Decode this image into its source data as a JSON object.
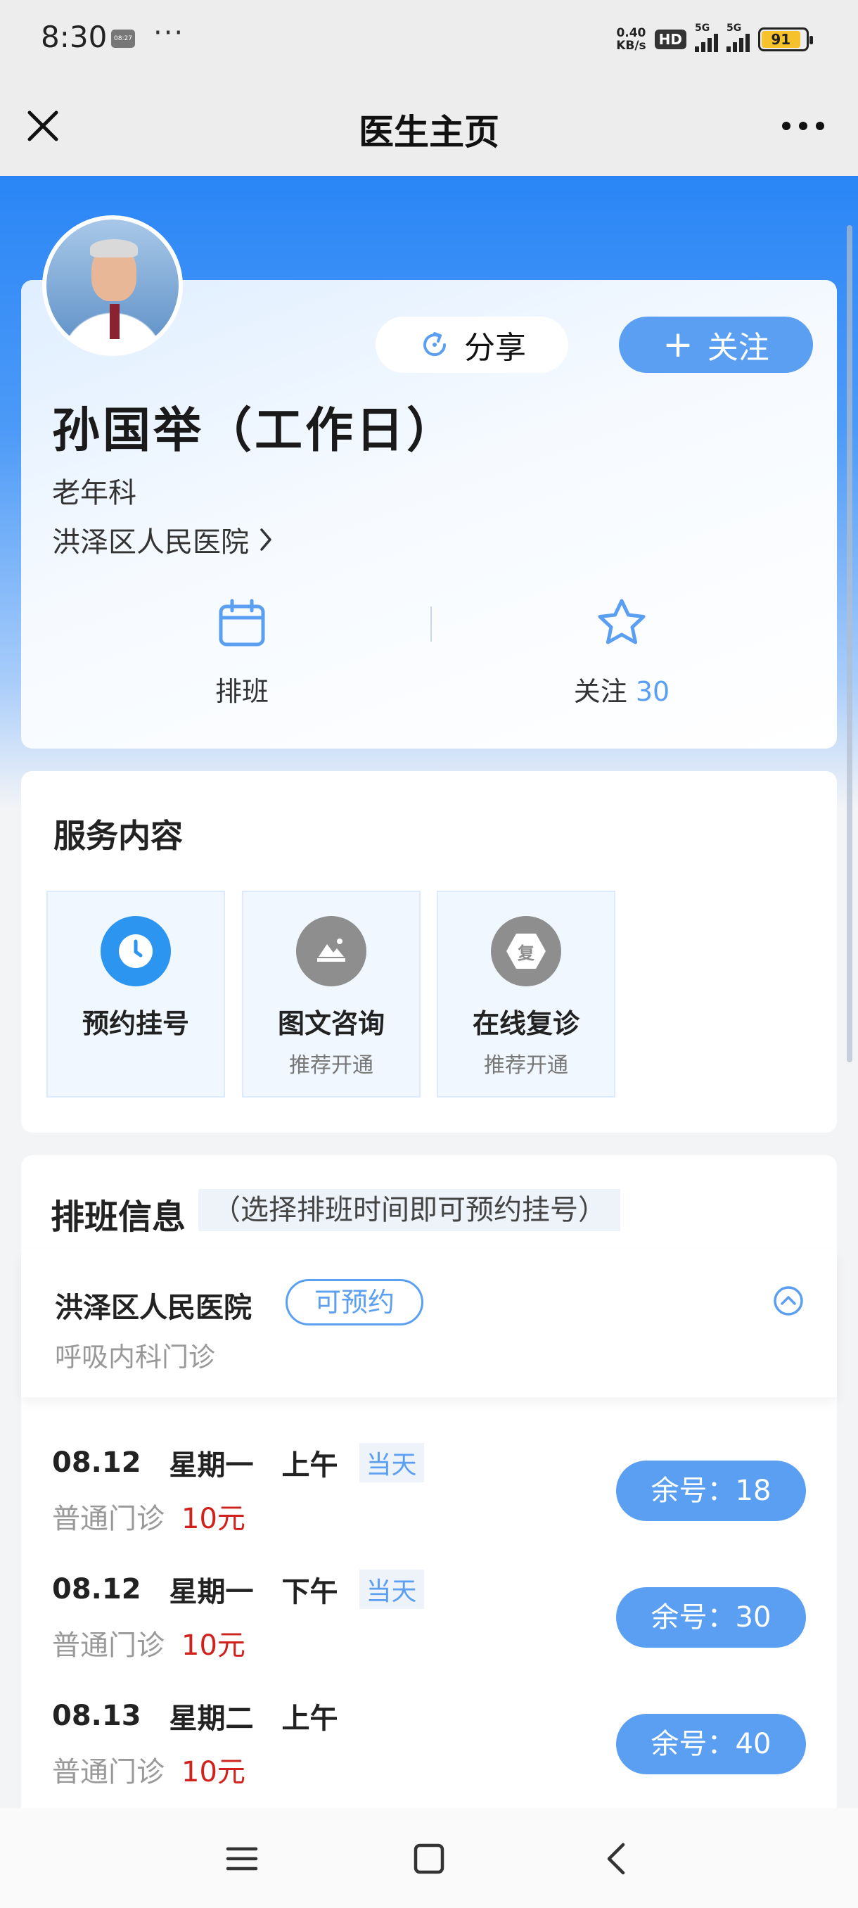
{
  "status_bar": {
    "time": "8:30",
    "mini_icon_text": "08:27",
    "more": "···",
    "net_speed_value": "0.40",
    "net_speed_unit": "KB/s",
    "hd": "HD",
    "signal1": "5G",
    "signal2": "5G",
    "battery": "91"
  },
  "nav": {
    "title": "医生主页"
  },
  "doctor": {
    "name": "孙国举（工作日）",
    "department": "老年科",
    "hospital": "洪泽区人民医院",
    "share_label": "分享",
    "follow_label": "关注",
    "schedule_label": "排班",
    "followers_label": "关注",
    "followers_count": "30"
  },
  "services": {
    "title": "服务内容",
    "items": [
      {
        "title": "预约挂号",
        "subtitle": ""
      },
      {
        "title": "图文咨询",
        "subtitle": "推荐开通"
      },
      {
        "title": "在线复诊",
        "subtitle": "推荐开通",
        "icon_char": "复"
      }
    ]
  },
  "schedule": {
    "title": "排班信息",
    "hint": "（选择排班时间即可预约挂号）",
    "hospital_name": "洪泽区人民医院",
    "status_badge": "可预约",
    "department": "呼吸内科门诊",
    "slots": [
      {
        "date": "08.12",
        "weekday": "星期一",
        "period": "上午",
        "tag": "当天",
        "type": "普通门诊",
        "price": "10元",
        "remaining": "余号：18"
      },
      {
        "date": "08.12",
        "weekday": "星期一",
        "period": "下午",
        "tag": "当天",
        "type": "普通门诊",
        "price": "10元",
        "remaining": "余号：30"
      },
      {
        "date": "08.13",
        "weekday": "星期二",
        "period": "上午",
        "tag": "",
        "type": "普通门诊",
        "price": "10元",
        "remaining": "余号：40"
      }
    ]
  },
  "colors": {
    "primary": "#5a9ff2",
    "header_blue": "#2a86f6",
    "price_red": "#d0211c"
  },
  "icons": [
    "close-icon",
    "more-icon",
    "share-icon",
    "plus-icon",
    "calendar-icon",
    "star-icon",
    "clock-icon",
    "image-icon",
    "revisit-icon",
    "chevron-right-icon",
    "chevron-up-icon",
    "menu-icon",
    "home-icon",
    "back-icon"
  ]
}
